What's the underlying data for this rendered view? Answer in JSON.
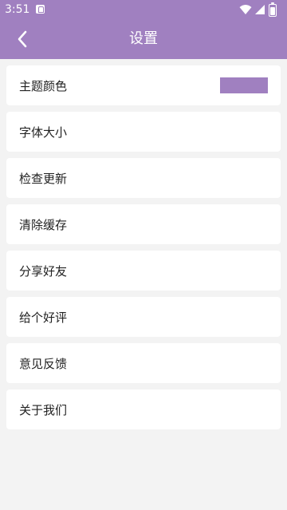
{
  "status": {
    "time": "3:51",
    "icons": [
      "app-notification-icon",
      "wifi-icon",
      "signal-icon",
      "battery-icon"
    ]
  },
  "appbar": {
    "title": "设置",
    "back_icon": "chevron-left-icon"
  },
  "colors": {
    "primary": "#a080c0",
    "background": "#f3f3f3",
    "card": "#ffffff"
  },
  "settings": {
    "items": [
      {
        "label": "主题颜色",
        "swatch_color": "#a080c0"
      },
      {
        "label": "字体大小"
      },
      {
        "label": "检查更新"
      },
      {
        "label": "清除缓存"
      },
      {
        "label": "分享好友"
      },
      {
        "label": "给个好评"
      },
      {
        "label": "意见反馈"
      },
      {
        "label": "关于我们"
      }
    ]
  }
}
